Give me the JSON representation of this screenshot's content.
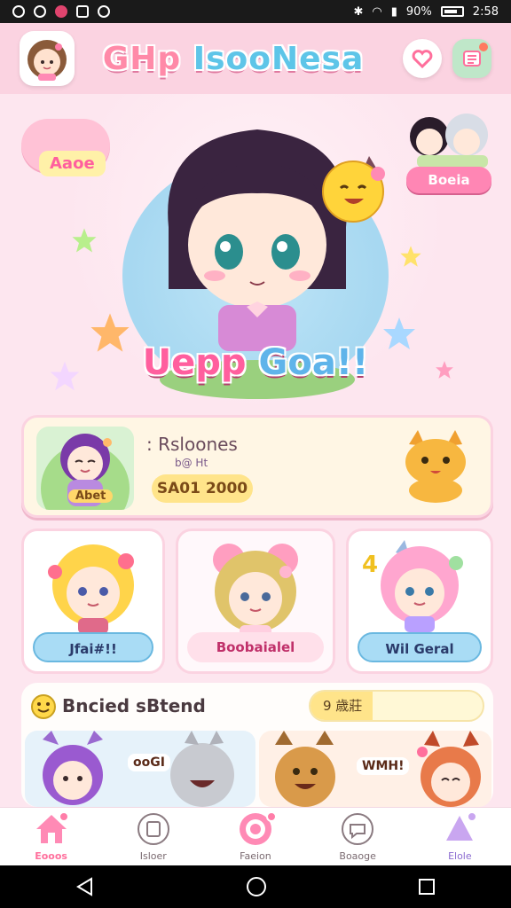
{
  "status_bar": {
    "battery": "90%",
    "time": "2:58"
  },
  "header": {
    "title_part1": "GHp",
    "title_part2": "IsooNesa"
  },
  "hero": {
    "badge_text": "Aaoe",
    "title_part1": "Uepp",
    "title_part2": "Goa!!",
    "friends_button": "Boeia"
  },
  "profile": {
    "name": "Rsloones",
    "sub": "b@ Ht",
    "avatar_tag": "Abet",
    "score": "SA01 2000"
  },
  "character_cards": [
    {
      "label": "Jfai#!!"
    },
    {
      "label": "Boobaialel"
    },
    {
      "label": "Wil Geral"
    }
  ],
  "friend_section": {
    "title": "Bncied sBtend",
    "search_value": "9 歳莊",
    "cards": [
      {
        "bubble": "ooGI"
      },
      {
        "bubble": "WMH!"
      }
    ]
  },
  "bottom_nav": [
    {
      "label": "Eooos",
      "active": true
    },
    {
      "label": "Isloer",
      "active": false
    },
    {
      "label": "Faeion",
      "active": false
    },
    {
      "label": "Boaoge",
      "active": false
    },
    {
      "label": "Elole",
      "active": false
    }
  ],
  "colors": {
    "accent_pink": "#ff86b4",
    "accent_blue": "#5ec5e8",
    "header_bg": "#fbd3e1",
    "card_cream": "#fff6e4"
  }
}
